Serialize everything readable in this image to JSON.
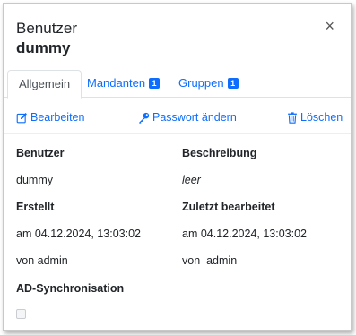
{
  "dialog": {
    "title": "Benutzer",
    "subtitle": "dummy",
    "close_symbol": "×"
  },
  "tabs": [
    {
      "label": "Allgemein",
      "active": true
    },
    {
      "label": "Mandanten",
      "badge": "1"
    },
    {
      "label": "Gruppen",
      "badge": "1"
    }
  ],
  "actions": {
    "edit": {
      "label": "Bearbeiten",
      "icon": "edit-icon"
    },
    "password": {
      "label": "Passwort ändern",
      "icon": "key-icon"
    },
    "delete": {
      "label": "Löschen",
      "icon": "trash-icon"
    }
  },
  "fields": {
    "user_label": "Benutzer",
    "user_value": "dummy",
    "description_label": "Beschreibung",
    "description_value": "leer",
    "created_label": "Erstellt",
    "created_value": "am 04.12.2024, 13:03:02",
    "created_by": "von admin",
    "modified_label": "Zuletzt bearbeitet",
    "modified_value": "am 04.12.2024, 13:03:02",
    "modified_by": "von  admin",
    "ad_sync_label": "AD-Synchronisation",
    "ad_sync_checked": false
  },
  "colors": {
    "accent": "#0d6efd",
    "text": "#212529"
  }
}
